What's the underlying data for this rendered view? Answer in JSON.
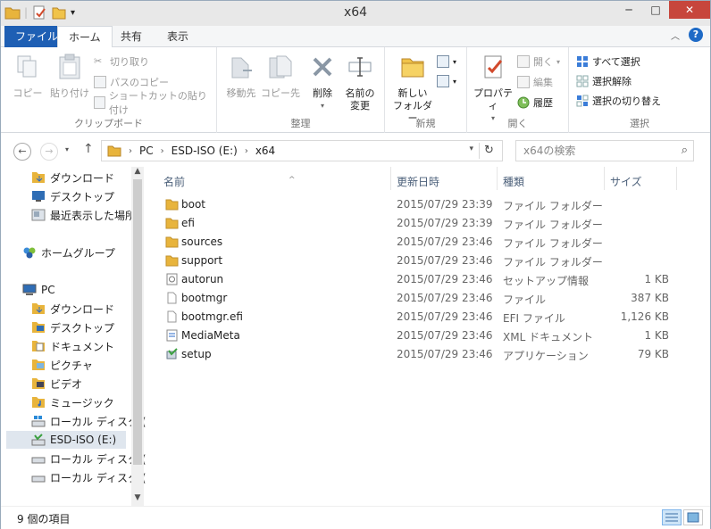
{
  "window": {
    "title": "x64"
  },
  "tabs": [
    {
      "label": "ファイル"
    },
    {
      "label": "ホーム"
    },
    {
      "label": "共有"
    },
    {
      "label": "表示"
    }
  ],
  "ribbon": {
    "clipboard": {
      "label": "クリップボード",
      "copy": "コピー",
      "paste": "貼り付け",
      "cut": "切り取り",
      "copy_path": "パスのコピー",
      "paste_shortcut": "ショートカットの貼り付け"
    },
    "organize": {
      "label": "整理",
      "move_to": "移動先",
      "copy_to": "コピー先",
      "delete": "削除",
      "rename_l1": "名前の",
      "rename_l2": "変更"
    },
    "new": {
      "label": "新規",
      "new_folder_l1": "新しい",
      "new_folder_l2": "フォルダー"
    },
    "open": {
      "label": "開く",
      "properties": "プロパティ",
      "open": "開く",
      "edit": "編集",
      "history": "履歴"
    },
    "select": {
      "label": "選択",
      "select_all": "すべて選択",
      "select_none": "選択解除",
      "invert": "選択の切り替え"
    }
  },
  "address": {
    "segments": [
      "PC",
      "ESD-ISO (E:)",
      "x64"
    ],
    "search_placeholder": "x64の検索"
  },
  "navpane": {
    "items": [
      {
        "label": "ダウンロード",
        "icon": "download-folder-icon"
      },
      {
        "label": "デスクトップ",
        "icon": "desktop-icon"
      },
      {
        "label": "最近表示した場所",
        "icon": "recent-places-icon"
      },
      {
        "label": "ホームグループ",
        "icon": "homegroup-icon"
      },
      {
        "label": "PC",
        "icon": "pc-icon"
      },
      {
        "label": "ダウンロード",
        "icon": "download-folder-icon"
      },
      {
        "label": "デスクトップ",
        "icon": "desktop-folder-icon"
      },
      {
        "label": "ドキュメント",
        "icon": "documents-folder-icon"
      },
      {
        "label": "ピクチャ",
        "icon": "pictures-folder-icon"
      },
      {
        "label": "ビデオ",
        "icon": "videos-folder-icon"
      },
      {
        "label": "ミュージック",
        "icon": "music-folder-icon"
      },
      {
        "label": "ローカル ディスク (C:)",
        "icon": "windows-drive-icon"
      },
      {
        "label": "ESD-ISO (E:)",
        "icon": "dvd-drive-icon"
      },
      {
        "label": "ローカル ディスク (F:)",
        "icon": "drive-icon"
      },
      {
        "label": "ローカル ディスク (G:)",
        "icon": "drive-icon"
      }
    ]
  },
  "columns": {
    "name": "名前",
    "date": "更新日時",
    "type": "種類",
    "size": "サイズ"
  },
  "files": [
    {
      "name": "boot",
      "date": "2015/07/29 23:39",
      "type": "ファイル フォルダー",
      "size": "",
      "icon": "folder-icon"
    },
    {
      "name": "efi",
      "date": "2015/07/29 23:39",
      "type": "ファイル フォルダー",
      "size": "",
      "icon": "folder-icon"
    },
    {
      "name": "sources",
      "date": "2015/07/29 23:46",
      "type": "ファイル フォルダー",
      "size": "",
      "icon": "folder-icon"
    },
    {
      "name": "support",
      "date": "2015/07/29 23:46",
      "type": "ファイル フォルダー",
      "size": "",
      "icon": "folder-icon"
    },
    {
      "name": "autorun",
      "date": "2015/07/29 23:46",
      "type": "セットアップ情報",
      "size": "1 KB",
      "icon": "setup-info-icon"
    },
    {
      "name": "bootmgr",
      "date": "2015/07/29 23:46",
      "type": "ファイル",
      "size": "387 KB",
      "icon": "file-icon"
    },
    {
      "name": "bootmgr.efi",
      "date": "2015/07/29 23:46",
      "type": "EFI ファイル",
      "size": "1,126 KB",
      "icon": "file-icon"
    },
    {
      "name": "MediaMeta",
      "date": "2015/07/29 23:46",
      "type": "XML ドキュメント",
      "size": "1 KB",
      "icon": "xml-icon"
    },
    {
      "name": "setup",
      "date": "2015/07/29 23:46",
      "type": "アプリケーション",
      "size": "79 KB",
      "icon": "setup-app-icon"
    }
  ],
  "status": {
    "count": "9 個の項目"
  },
  "colors": {
    "file_tab": "#1e5fb4",
    "close": "#c7463c",
    "folder": "#e8b43c",
    "selection": "#dfe6ee"
  }
}
